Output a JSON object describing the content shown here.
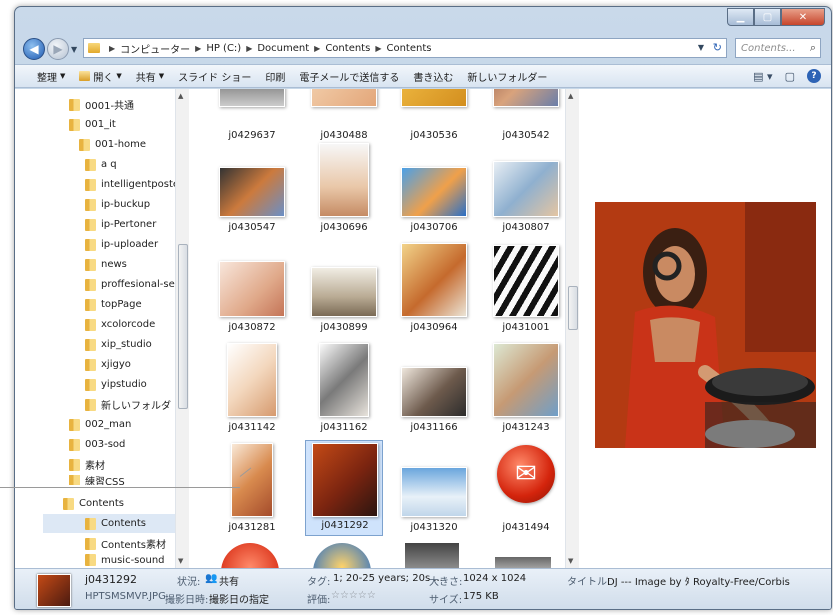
{
  "address": {
    "crumbs": [
      "コンピューター",
      "HP (C:)",
      "Document",
      "Contents",
      "Contents"
    ],
    "search_placeholder": "Contents..."
  },
  "toolbar": {
    "items": [
      "整理",
      "開く",
      "共有",
      "スライド ショー",
      "印刷",
      "電子メールで送信する",
      "書き込む",
      "新しいフォルダー"
    ]
  },
  "nav": {
    "items": [
      "0001-共通",
      "001_it",
      "001-home",
      "a q",
      "intelligentposter",
      "ip-buckup",
      "ip-Pertoner",
      "ip-uploader",
      "news",
      "proffesional-servi",
      "topPage",
      "xcolorcode",
      "xip_studio",
      "xjigyo",
      "yipstudio",
      "新しいフォルダ",
      "002_man",
      "003-sod",
      "素材",
      "練習CSS",
      "Contents",
      "Contents",
      "Contents素材",
      "music-sound"
    ]
  },
  "files": {
    "items": [
      "j0429637",
      "j0430488",
      "j0430536",
      "j0430542",
      "j0430547",
      "j0430696",
      "j0430706",
      "j0430807",
      "j0430872",
      "j0430899",
      "j0430964",
      "j0431001",
      "j0431142",
      "j0431162",
      "j0431166",
      "j0431243",
      "j0431281",
      "j0431292",
      "j0431320",
      "j0431494"
    ],
    "selected": "j0431292"
  },
  "details": {
    "name": "j0431292",
    "filename": "HPTSMSMVP.JPG",
    "date_label": "撮影日時:",
    "date_value": "撮影日の指定",
    "state_label": "状況:",
    "state_value": "共有",
    "tags_label": "タグ:",
    "tags_value": "1; 20-25 years; 20s ...",
    "rating_label": "評価:",
    "rating_value": "☆☆☆☆☆",
    "dim_label": "大きさ:",
    "dim_value": "1024 x 1024",
    "size_label": "サイズ:",
    "size_value": "175 KB",
    "title_label": "タイトル:",
    "title_value": "DJ --- Image by ﾀ Royalty-Free/Corbis"
  }
}
